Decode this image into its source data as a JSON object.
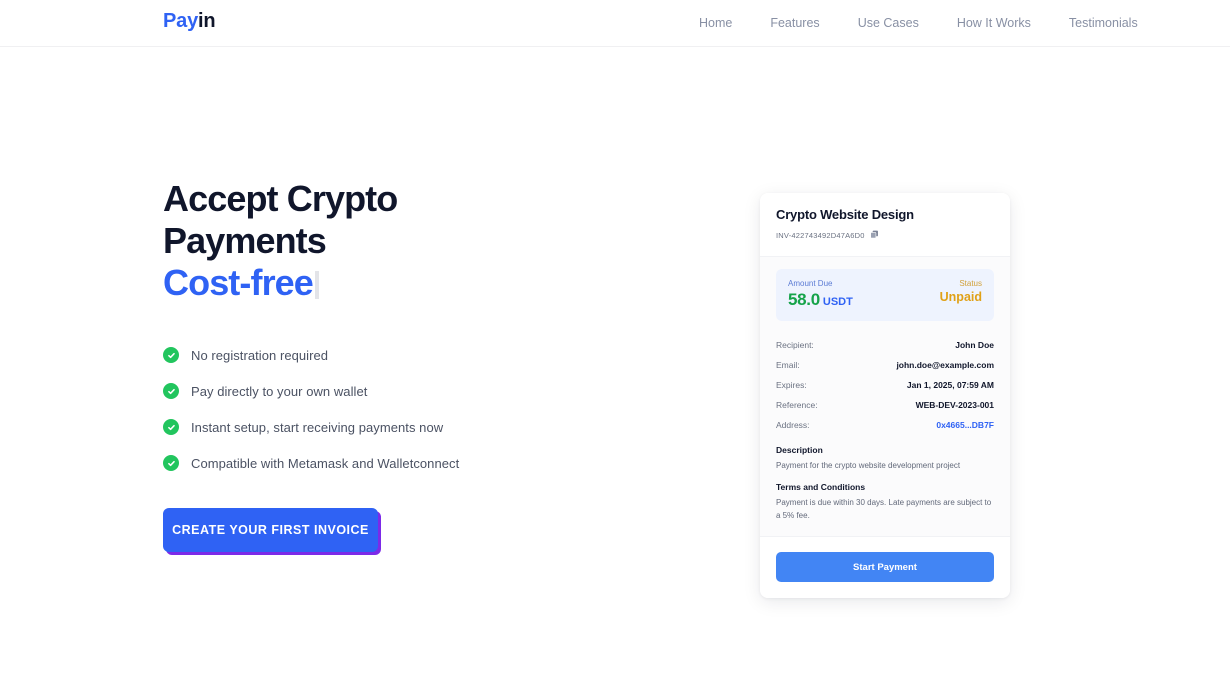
{
  "header": {
    "logo": {
      "part1": "Pay",
      "part2": "in"
    },
    "nav": [
      {
        "label": "Home"
      },
      {
        "label": "Features"
      },
      {
        "label": "Use Cases"
      },
      {
        "label": "How It Works"
      },
      {
        "label": "Testimonials"
      }
    ]
  },
  "hero": {
    "headline_line1": "Accept Crypto",
    "headline_line2": "Payments",
    "headline_accent": "Cost-free",
    "features": [
      {
        "label": "No registration required"
      },
      {
        "label": "Pay directly to your own wallet"
      },
      {
        "label": "Instant setup, start receiving payments now"
      },
      {
        "label": "Compatible with Metamask and Walletconnect"
      }
    ],
    "cta_label": "CREATE YOUR FIRST INVOICE"
  },
  "invoice": {
    "title": "Crypto Website Design",
    "number": "INV-422743492D47A6D0",
    "amount_label": "Amount Due",
    "amount_value": "58.0",
    "amount_unit": "USDT",
    "status_label": "Status",
    "status_value": "Unpaid",
    "rows": [
      {
        "label": "Recipient:",
        "value": "John Doe",
        "link": false
      },
      {
        "label": "Email:",
        "value": "john.doe@example.com",
        "link": false
      },
      {
        "label": "Expires:",
        "value": "Jan 1, 2025, 07:59 AM",
        "link": false
      },
      {
        "label": "Reference:",
        "value": "WEB-DEV-2023-001",
        "link": false
      },
      {
        "label": "Address:",
        "value": "0x4665...DB7F",
        "link": true
      }
    ],
    "description_title": "Description",
    "description_text": "Payment for the crypto website development project",
    "terms_title": "Terms and Conditions",
    "terms_text": "Payment is due within 30 days. Late payments are subject to a 5% fee.",
    "start_button": "Start Payment"
  },
  "colors": {
    "brand_blue": "#2f62f4",
    "dark": "#10162b",
    "green": "#22c55e",
    "amount_green": "#16a34a",
    "status_amber": "#e0a117",
    "cta_shadow_purple": "#7c2ae8"
  }
}
